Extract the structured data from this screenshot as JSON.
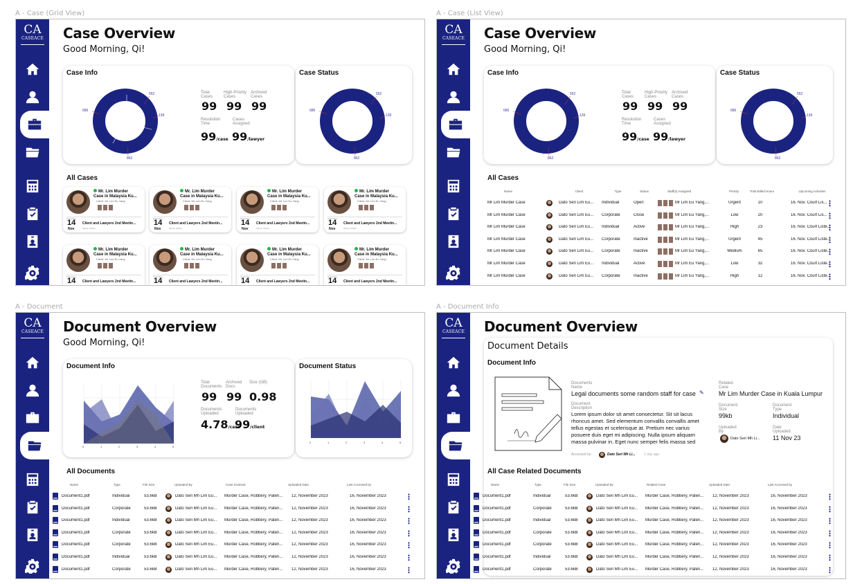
{
  "frames": {
    "f1_label": "A - Case (Grid View)",
    "f2_label": "A - Case (List View)",
    "f3_label": "A - Document",
    "f4_label": "A - Document Info"
  },
  "brand": {
    "logo": "CA",
    "name": "CASEACE"
  },
  "nav_icons": [
    "home-icon",
    "user-icon",
    "briefcase-icon",
    "folder-icon",
    "calculator-icon",
    "clipboard-check-icon",
    "id-badge-icon",
    "settings-gear-icon"
  ],
  "colors": {
    "primary": "#1b2380",
    "online": "#28b04a"
  },
  "case": {
    "title": "Case Overview",
    "greeting": "Good Morning, Qi!",
    "info_title": "Case Info",
    "status_title": "Case Status",
    "donut_labels": [
      "552",
      "139",
      "862",
      "686"
    ],
    "stats": {
      "total_cases_label": "Total Cases",
      "total_cases": "99",
      "high_priority_label": "High-Priority Cases",
      "high_priority": "99",
      "archived_label": "Archived Cases",
      "archived": "99",
      "resolution_label": "Resolution Time",
      "resolution": "99",
      "resolution_unit": "/case",
      "assigned_label": "Cases Assigned",
      "assigned": "99",
      "assigned_unit": "/lawyer"
    },
    "all_cases_title": "All Cases",
    "card": {
      "title1": "Mr. Lim Murder",
      "title2": "Case in Malaysia Ku...",
      "client": "Client: Mr. Lim Eu Yang",
      "upcoming": "Upcoming",
      "day": "14",
      "month": "Nov",
      "event": "Client and Lawyers 2nd Meetin...",
      "venue": "Venue: Online"
    },
    "list_headers": [
      "Name",
      "Client",
      "Type",
      "Status",
      "Staff(s) Assigned",
      "Priority",
      "Total Billed Hours",
      "Upcoming Activities"
    ],
    "list_rows": [
      [
        "Mr Lim Murder Case",
        "Dato Seri Lim Eu...",
        "Individual",
        "Open",
        "Mr Lim Eu Yang,...",
        "Urgent",
        "10",
        "16. Nov. Court Lis..."
      ],
      [
        "Mr Lim Murder Case",
        "Dato Seri Lim Eu...",
        "Corporate",
        "Close",
        "Mr Lim Eu Yang,...",
        "Low",
        "20",
        "16. Nov. Court Lis..."
      ],
      [
        "Mr Lim Murder Case",
        "Dato Seri Lim Eu...",
        "Individual",
        "Active",
        "Mr Lim Eu Yang,...",
        "High",
        "23",
        "16. Nov. Court Liste..."
      ],
      [
        "Mr Lim Murder Case",
        "Dato Seri Lim Eu...",
        "Corporate",
        "Inactive",
        "Mr Lim Eu Yang,...",
        "Urgent",
        "45",
        "16. Nov. Court Liste..."
      ],
      [
        "Mr Lim Murder Case",
        "Dato Seri Lim Eu...",
        "Corporate",
        "Inactive",
        "Mr Lim Eu Yang,...",
        "Medium",
        "65",
        "16. Nov. Court Liste..."
      ],
      [
        "Mr Lim Murder Case",
        "Dato Seri Lim Eu...",
        "Individual",
        "Active",
        "Mr Lim Eu Yang,...",
        "Low",
        "32",
        "16. Nov. Court Liste..."
      ],
      [
        "Mr Lim Murder Case",
        "Dato Seri Lim Eu...",
        "Corporate",
        "Inactive",
        "Mr Lim Eu Yang,...",
        "High",
        "12",
        "16. Nov. Court Liste..."
      ]
    ]
  },
  "doc": {
    "title": "Document Overview",
    "greeting": "Good Morning, Qi!",
    "info_title": "Document Info",
    "status_title": "Document Status",
    "stats": {
      "total_label": "Total Documents",
      "total": "99",
      "archived_label": "Archived Docs",
      "archived": "99",
      "size_label": "Size (GB)",
      "size": "0.98",
      "uploaded_label": "Documents Uploaded",
      "uploaded": "4.78",
      "uploaded_unit": "/case",
      "uploaded2_label": "Documents Uploaded",
      "uploaded2": "99",
      "uploaded2_unit": "/client"
    },
    "x_ticks": [
      "0",
      "1",
      "2",
      "3",
      "4",
      "5"
    ],
    "y_ticks": [
      "1",
      "0",
      "0",
      "5",
      "5",
      "0",
      "0",
      "5",
      "2",
      "0"
    ],
    "all_docs_title": "All Documents",
    "related_title": "All Case Related Documents",
    "headers": [
      "Name",
      "Type",
      "File Size",
      "Uploaded By",
      "Case Involved",
      "Uploaded Date",
      "Last Accessed by"
    ],
    "headers_info": [
      "Name",
      "Type",
      "File Size",
      "Uploaded By",
      "Related Case",
      "Uploaded Date",
      "Last Accessed by"
    ],
    "rows": [
      [
        "Document1.pdf",
        "Individual",
        "53.6kB",
        "Dato Seri Mh Lim Eu...",
        "Murder Case, Robbery, Paten...",
        "12, November 2023",
        "16, November 2023"
      ],
      [
        "Document1.pdf",
        "Corporate",
        "53.6kB",
        "Dato Seri Mh Lim Eu...",
        "Murder Case, Robbery, Paten...",
        "12, November 2023",
        "16, November 2023"
      ],
      [
        "Document1.pdf",
        "Individual",
        "53.6kB",
        "Dato Seri Mh Lim Eu...",
        "Murder Case, Robbery, Paten...",
        "12, November 2023",
        "16, November 2023"
      ],
      [
        "Document1.pdf",
        "Corporate",
        "53.6kB",
        "Dato Seri Mh Lim Eu...",
        "Murder Case, Robbery, Paten...",
        "12, November 2023",
        "16, November 2023"
      ],
      [
        "Document1.pdf",
        "Corporate",
        "53.6kB",
        "Dato Seri Mh Lim Eu...",
        "Murder Case, Robbery, Paten...",
        "12, November 2023",
        "16, November 2023"
      ],
      [
        "Document1.pdf",
        "Individual",
        "53.6kB",
        "Dato Seri Mh Lim Eu...",
        "Murder Case, Robbery, Paten...",
        "12, November 2023",
        "16, November 2023"
      ],
      [
        "Document1.pdf",
        "Corporate",
        "53.6kB",
        "Dato Seri Mh Lim Eu...",
        "Murder Case, Robbery, Paten...",
        "12, November 2023",
        "16, November 2023"
      ]
    ],
    "details": {
      "heading": "Document Details",
      "name_label": "Documents Name",
      "name": "Legal documents some random staff for case",
      "desc_label": "Document Description",
      "desc": "Lorem ipsum dolor sit amet consectetur. Sit sit lacus rhoncus amet. Sed elementum convallis convallis amet tellus egestas et scelerisque at. Pretium nec varius posuere duis eget mi adipiscing. Nulla ipsum aliquam massa pulvinar in. Eget nunc semper felis massa sed",
      "accessed_label": "Accessed by:",
      "accessed_by": "Dato Seri Mh Li...",
      "accessed_when": "1 day ago",
      "related_label": "Related Case",
      "related": "Mr Lim Murder Case in Kuala Lumpur",
      "size_label": "Document Size",
      "size": "99kb",
      "type_label": "Document Type",
      "type": "Individual",
      "uploaded_by_label": "Uploaded By",
      "uploaded_by": "Dato Seri Mh Li...",
      "date_label": "Date Uploaded",
      "date": "11 Nov 23"
    }
  }
}
